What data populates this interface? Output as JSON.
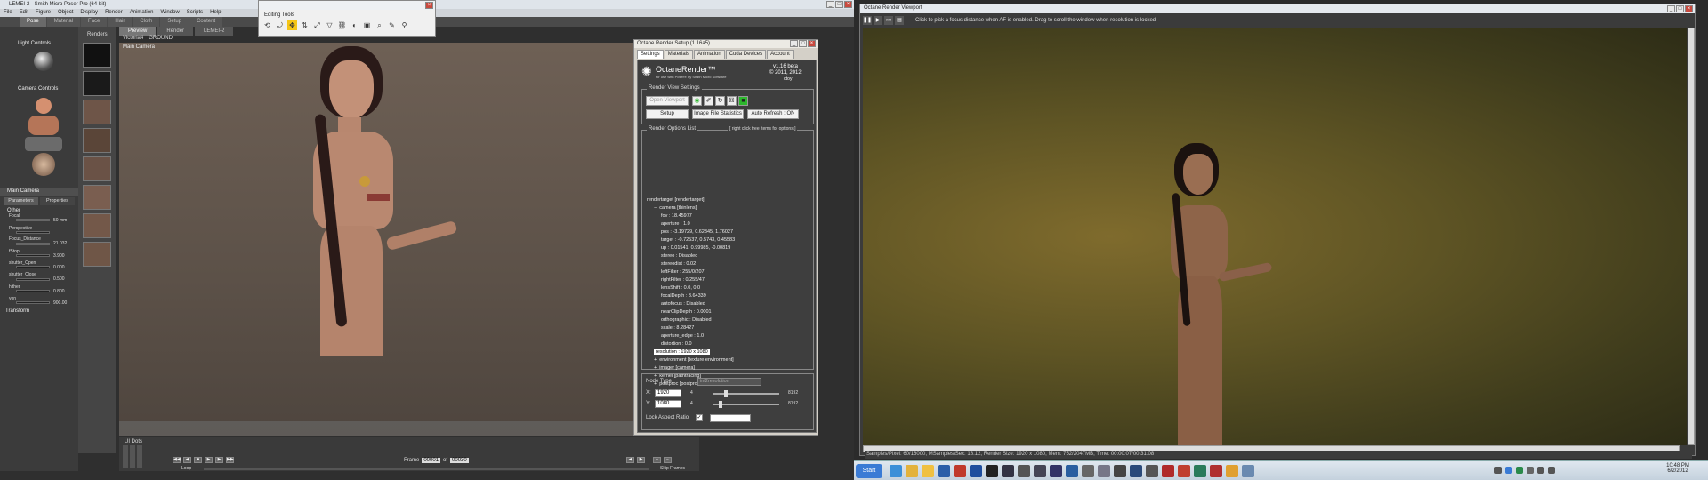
{
  "poser": {
    "title": "LEMEI-2 - Smith Micro Poser Pro  (64-bit)",
    "menu": [
      "File",
      "Edit",
      "Figure",
      "Object",
      "Display",
      "Render",
      "Animation",
      "Window",
      "Scripts",
      "Help"
    ],
    "tabs": [
      "Pose",
      "Material",
      "Face",
      "Hair",
      "Cloth",
      "Setup",
      "Content"
    ],
    "active_tab": "Pose",
    "light_controls": "Light Controls",
    "camera_controls": "Camera Controls",
    "main_camera": "Main Camera",
    "params_tabs": [
      "Parameters",
      "Properties"
    ],
    "other": "Other",
    "params": [
      {
        "label": "Focal",
        "value": "50 mm"
      },
      {
        "label": "Perspective",
        "value": ""
      },
      {
        "label": "Focus_Distance",
        "value": "21.032"
      },
      {
        "label": "fStop",
        "value": "3.900"
      },
      {
        "label": "shutter_Open",
        "value": "0.000"
      },
      {
        "label": "shutter_Close",
        "value": "0.500"
      },
      {
        "label": "hither",
        "value": "0.800"
      },
      {
        "label": "yon",
        "value": "900.00"
      }
    ],
    "transform": "Transform",
    "renders_label": "Renders",
    "view_tabs": [
      "Preview",
      "Render"
    ],
    "lemei_tab": "LEMEI-2",
    "figure_select": "Victoria4",
    "actor_select": "GROUND",
    "camera_label": "Main Camera",
    "ui_dots": "UI Dots",
    "frame_label": "Frame",
    "frame_value": "00001",
    "frame_of": "of",
    "frame_total": "00030",
    "loop_label": "Loop",
    "skip_frames": "Skip Frames"
  },
  "editing_tools": {
    "title": "Editing Tools"
  },
  "octane_setup": {
    "title": "Octane Render Setup (1.16a5)",
    "tabs": [
      "Settings",
      "Materials",
      "Animation",
      "Cuda Devices",
      "Account"
    ],
    "active_tab": "Settings",
    "logo_text": "OctaneRender™",
    "logo_sub": "for use with Poser® by Smith Micro Software",
    "version": "v1.16 beta",
    "copyright": "© 2011, 2012",
    "brand": "otoy",
    "render_view_settings": "Render View Settings",
    "open_viewport": "Open Viewport",
    "setup_button": "Setup",
    "image_stats_button": "Image File Statistics",
    "auto_refresh_button": "Auto Refresh : ON",
    "render_options_list": "Render Options List",
    "tree_hint": "[ right click tree items for options ]",
    "tree": [
      {
        "indent": 0,
        "text": "rendertarget  [rendertarget]"
      },
      {
        "indent": 1,
        "text": "camera  [thinlens]",
        "toggle": "−"
      },
      {
        "indent": 2,
        "text": "fov  :  18.45977"
      },
      {
        "indent": 2,
        "text": "aperture  :  1.0"
      },
      {
        "indent": 2,
        "text": "pos  :  -3.19729, 0.62345, 1.76027"
      },
      {
        "indent": 2,
        "text": "target  :  -0.72537, 0.5743, 0.45583"
      },
      {
        "indent": 2,
        "text": "up  :  0.01541, 0.99985, -0.00819"
      },
      {
        "indent": 2,
        "text": "stereo  :  Disabled"
      },
      {
        "indent": 2,
        "text": "stereodist  :  0.02"
      },
      {
        "indent": 2,
        "text": "leftFilter  :  255/0/207"
      },
      {
        "indent": 2,
        "text": "rightFilter  :  0/255/47"
      },
      {
        "indent": 2,
        "text": "lensShift  :  0.0, 0.0"
      },
      {
        "indent": 2,
        "text": "focalDepth  :  3.64339"
      },
      {
        "indent": 2,
        "text": "autofocus  :  Disabled"
      },
      {
        "indent": 2,
        "text": "nearClipDepth  :  0.0001"
      },
      {
        "indent": 2,
        "text": "orthographic  :  Disabled"
      },
      {
        "indent": 2,
        "text": "scale  :  8.28427"
      },
      {
        "indent": 2,
        "text": "aperture_edge  :  1.0"
      },
      {
        "indent": 2,
        "text": "distortion  :  0.0"
      },
      {
        "indent": 1,
        "text": "resolution  :  1920 x 1080",
        "selected": true
      },
      {
        "indent": 1,
        "text": "environment  [texture environment]",
        "toggle": "+"
      },
      {
        "indent": 1,
        "text": "imager  [camera]",
        "toggle": "+"
      },
      {
        "indent": 1,
        "text": "kernel  [pathtracing]",
        "toggle": "+"
      },
      {
        "indent": 1,
        "text": "postproc  [postprocessing]",
        "toggle": "+"
      }
    ],
    "node_type_label": "Node Type",
    "node_type_value": "int2resolution",
    "x_label": "X:",
    "x_value": "1920",
    "y_label": "Y:",
    "y_value": "1080",
    "min_value": "4",
    "max_value": "8192",
    "lock_aspect": "Lock Aspect Ratio"
  },
  "octane_viewport": {
    "title": "Octane Render Viewport",
    "hint": "Click to pick a focus distance when AF is enabled.  Drag to scroll the window when resolution is locked",
    "status": "Samples/Pixel: 60/16000,  MSamples/Sec: 18.12,  Render Size: 1920 x 1080,  Mem: 752/2047MB,  Time: 00:00:07/00:31:08"
  },
  "taskbar": {
    "start": "Start",
    "time": "10:48 PM",
    "date": "6/2/2012"
  },
  "colors": {
    "accent": "#f5c518",
    "octane_green": "#2db82d"
  }
}
